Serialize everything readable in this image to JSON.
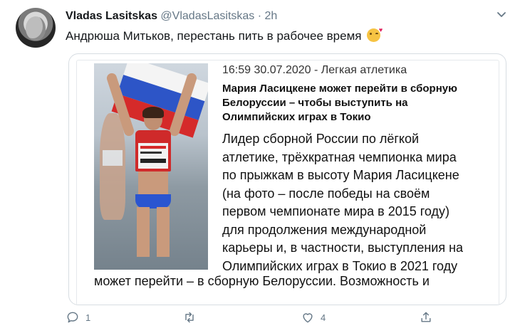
{
  "tweet": {
    "author_name": "Vladas Lasitskas",
    "handle": "@VladasLasitskas",
    "time": "2h",
    "text": "Андрюша Митьков, перестань пить в рабочее время",
    "emoji": "face-blowing-kiss-emoji"
  },
  "card": {
    "dateline": "16:59  30.07.2020 - Легкая атлетика",
    "headline_lines": [
      "Мария Ласицкене может перейти в сборную",
      "Белоруссии – чтобы выступить на",
      "Олимпийских играх в Токио"
    ],
    "lead_lines": [
      "Лидер сборной России по лёгкой",
      "атлетике, трёхкратная чемпионка мира",
      "по прыжкам в высоту Мария Ласицкене",
      "(на фото – после победы на своём",
      "первом чемпионате мира в 2015 году)",
      "для продолжения международной",
      "карьеры и, в частности, выступления на",
      "Олимпийских играх в Токио в 2021 году"
    ],
    "continuation": "может перейти – в сборную Белоруссии. Возможность и",
    "photo": {
      "bib_name": "KUCHINA",
      "bib_country": "RUSSIA",
      "bib_sponsor": "TOYOTA",
      "other_bib": "DRO"
    }
  },
  "actions": {
    "reply_count": "1",
    "retweet_count": "",
    "like_count": "4",
    "share_count": ""
  },
  "icons": {
    "reply": "reply-icon",
    "retweet": "retweet-icon",
    "like": "heart-icon",
    "share": "share-icon",
    "menu": "chevron-down-icon"
  },
  "colors": {
    "name": "#14171a",
    "meta": "#657786",
    "card_border": "#d7dde2"
  }
}
